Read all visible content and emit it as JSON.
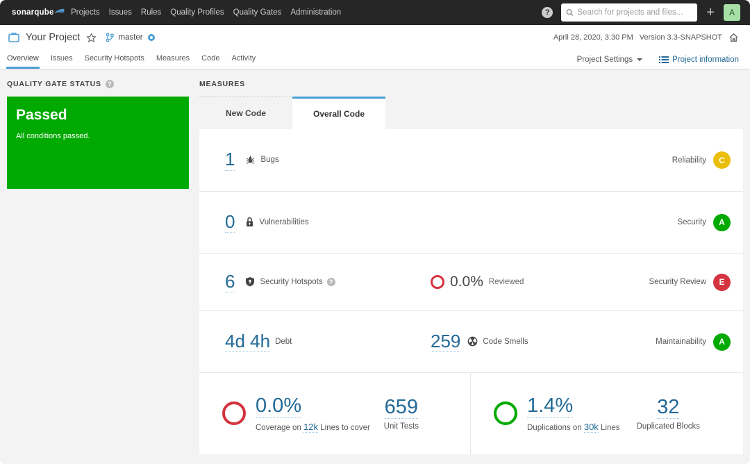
{
  "topnav": {
    "logo": "sonarqube",
    "items": [
      "Projects",
      "Issues",
      "Rules",
      "Quality Profiles",
      "Quality Gates",
      "Administration"
    ],
    "help": "?",
    "search_placeholder": "Search for projects and files...",
    "plus": "+",
    "avatar": "A"
  },
  "header": {
    "project": "Your Project",
    "branch": "master",
    "date": "April 28, 2020, 3:30 PM",
    "version": "Version 3.3-SNAPSHOT"
  },
  "tabs": {
    "items": [
      "Overview",
      "Issues",
      "Security Hotspots",
      "Measures",
      "Code",
      "Activity"
    ],
    "settings": "Project Settings",
    "info": "Project information"
  },
  "quality_gate": {
    "title": "QUALITY GATE STATUS",
    "status": "Passed",
    "subtitle": "All conditions passed."
  },
  "measures": {
    "title": "MEASURES",
    "tab_new": "New Code",
    "tab_overall": "Overall Code",
    "rows": [
      {
        "value": "1",
        "label": "Bugs",
        "rating_label": "Reliability",
        "rating": "C",
        "rating_color": "#eabe06"
      },
      {
        "value": "0",
        "label": "Vulnerabilities",
        "rating_label": "Security",
        "rating": "A",
        "rating_color": "#00aa00"
      },
      {
        "value": "6",
        "label": "Security Hotspots",
        "mid_value": "0.0%",
        "mid_label": "Reviewed",
        "rating_label": "Security Review",
        "rating": "E",
        "rating_color": "#d4333f"
      },
      {
        "value": "4d 4h",
        "label": "Debt",
        "mid_value": "259",
        "mid_label": "Code Smells",
        "rating_label": "Maintainability",
        "rating": "A",
        "rating_color": "#00aa00"
      }
    ],
    "footer": {
      "coverage_pct": "0.0%",
      "coverage_pre": "Coverage on",
      "coverage_link": "12k",
      "coverage_post": "Lines to cover",
      "unit_tests": "659",
      "unit_tests_label": "Unit Tests",
      "dup_pct": "1.4%",
      "dup_pre": "Duplications on",
      "dup_link": "30k",
      "dup_post": "Lines",
      "dup_blocks": "32",
      "dup_blocks_label": "Duplicated Blocks"
    }
  }
}
